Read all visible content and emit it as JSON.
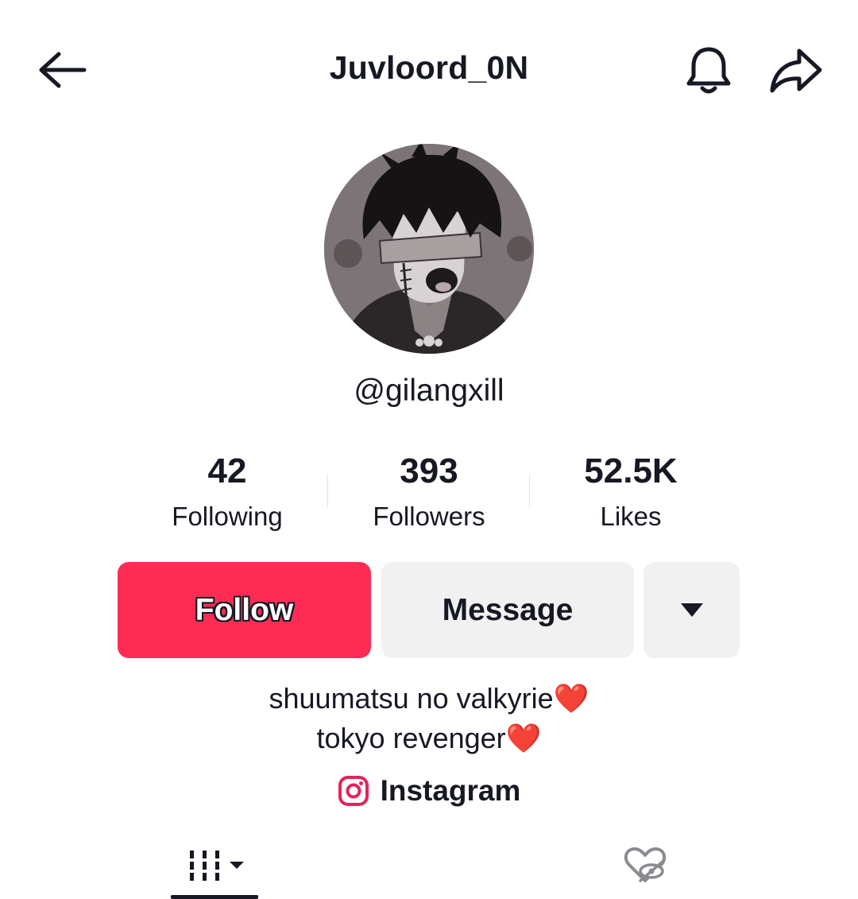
{
  "header": {
    "title": "Juvloord_0N",
    "back_icon": "back-arrow-icon",
    "bell_icon": "bell-icon",
    "share_icon": "share-icon"
  },
  "profile": {
    "username": "@gilangxill",
    "avatar": "avatar-image"
  },
  "stats": [
    {
      "value": "42",
      "label": "Following"
    },
    {
      "value": "393",
      "label": "Followers"
    },
    {
      "value": "52.5K",
      "label": "Likes"
    }
  ],
  "actions": {
    "follow_label": "Follow",
    "message_label": "Message",
    "more_icon": "caret-down-icon"
  },
  "bio": {
    "line1": "shuumatsu no valkyrie",
    "line2": "tokyo revenger",
    "heart": "❤️"
  },
  "link": {
    "label": "Instagram",
    "icon": "instagram-icon"
  },
  "tabs": [
    {
      "name": "videos",
      "icon": "grid-icon",
      "active": true
    },
    {
      "name": "liked",
      "icon": "liked-hidden-icon",
      "active": false
    }
  ],
  "colors": {
    "accent": "#fe2c55",
    "text": "#161823",
    "button_gray": "#f1f1f2",
    "heart": "#e8262a"
  }
}
